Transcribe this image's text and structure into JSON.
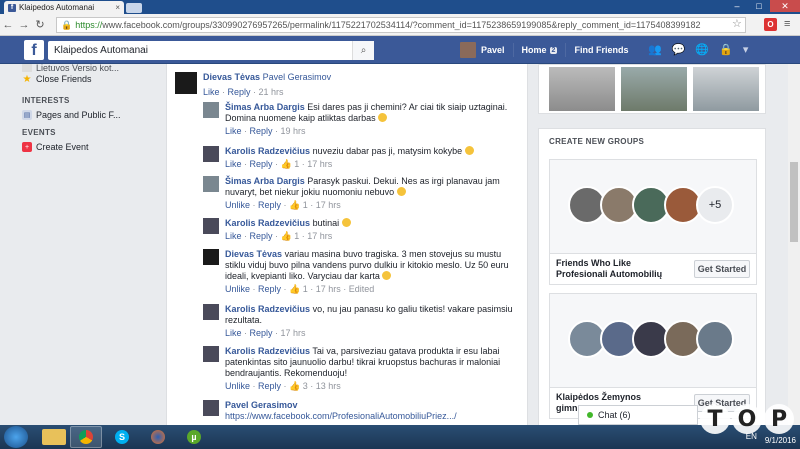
{
  "browser": {
    "tab_title": "Klaipedos Automanai",
    "url_https": "https://",
    "url_rest": "www.facebook.com/groups/330990276957265/permalink/1175221702534114/?comment_id=1175238659199085&reply_comment_id=1175408399182"
  },
  "fb": {
    "search_value": "Klaipedos Automanai",
    "user_name": "Pavel",
    "home_label": "Home",
    "home_count": "2",
    "find_friends": "Find Friends"
  },
  "left": {
    "item_cut": "Lietuvos Versio kot...",
    "close_friends": "Close Friends",
    "interests_header": "INTERESTS",
    "pages_public": "Pages and Public F...",
    "events_header": "EVENTS",
    "create_event": "Create Event"
  },
  "comments": [
    {
      "name": "Dievas Tėvas",
      "tag": "Pavel Gerasimov",
      "text": "",
      "meta_like": "Like",
      "meta_reply": "Reply",
      "likes": "",
      "time": "21 hrs"
    },
    {
      "name": "Šimas Arba Dargis",
      "text": "Esi dares pas ji chemini? Ar ciai tik siaip uztaginai. Domina nuomene kaip atliktas darbas",
      "meta_like": "Like",
      "meta_reply": "Reply",
      "likes": "",
      "time": "19 hrs"
    },
    {
      "name": "Karolis Radzevičius",
      "text": "nuveziu dabar pas ji, matysim kokybe",
      "meta_like": "Like",
      "meta_reply": "Reply",
      "likes": "1",
      "time": "17 hrs"
    },
    {
      "name": "Šimas Arba Dargis",
      "text": "Parasyk paskui. Dekui. Nes as irgi planavau jam nuvaryt, bet niekur jokiu nuomoniu nebuvo",
      "meta_like": "Unlike",
      "meta_reply": "Reply",
      "likes": "1",
      "time": "17 hrs"
    },
    {
      "name": "Karolis Radzevičius",
      "text": "butinai",
      "meta_like": "Like",
      "meta_reply": "Reply",
      "likes": "1",
      "time": "17 hrs"
    },
    {
      "name": "Dievas Tėvas",
      "text": "variau masina buvo tragiska. 3 men stovejus su mustu stiklu viduj buvo pilna vandens purvo dulkiu ir kitokio meslo. Uz 50 euru ideali, kvepianti liko. Varyciau dar karta",
      "meta_like": "Unlike",
      "meta_reply": "Reply",
      "likes": "1",
      "time": "17 hrs",
      "edited": "Edited"
    },
    {
      "name": "Karolis Radzevičius",
      "text": "vo, nu jau panasu ko galiu tiketis! vakare pasimsiu rezultata.",
      "meta_like": "Like",
      "meta_reply": "Reply",
      "likes": "",
      "time": "17 hrs"
    },
    {
      "name": "Karolis Radzevičius",
      "text": "Tai va, parsiveziau gatava produkta ir esu labai patenkintas sito jaunuolio darbu! tikrai kruopstus bachuras ir maloniai bendraujantis. Rekomenduoju!",
      "meta_like": "Unlike",
      "meta_reply": "Reply",
      "likes": "3",
      "time": "13 hrs"
    },
    {
      "name": "Pavel Gerasimov",
      "text": "https://www.facebook.com/ProfesionaliAutomobiliuPriez.../"
    }
  ],
  "right": {
    "create_groups_header": "CREATE NEW GROUPS",
    "group1_name_l1": "Friends Who Like",
    "group1_name_l2": "Profesionali Automobilių",
    "group1_more": "+5",
    "group2_name_l1": "Klaipėdos Žemynos",
    "group2_name_l2": "gimn...",
    "get_started": "Get Started",
    "chat_label": "Chat (6)"
  },
  "watermark": [
    "T",
    "O",
    "P"
  ],
  "taskbar": {
    "lang": "EN",
    "date": "9/1/2016"
  },
  "colors": {
    "fb_blue": "#3b5998",
    "link": "#365899",
    "bg": "#e9ebee"
  }
}
